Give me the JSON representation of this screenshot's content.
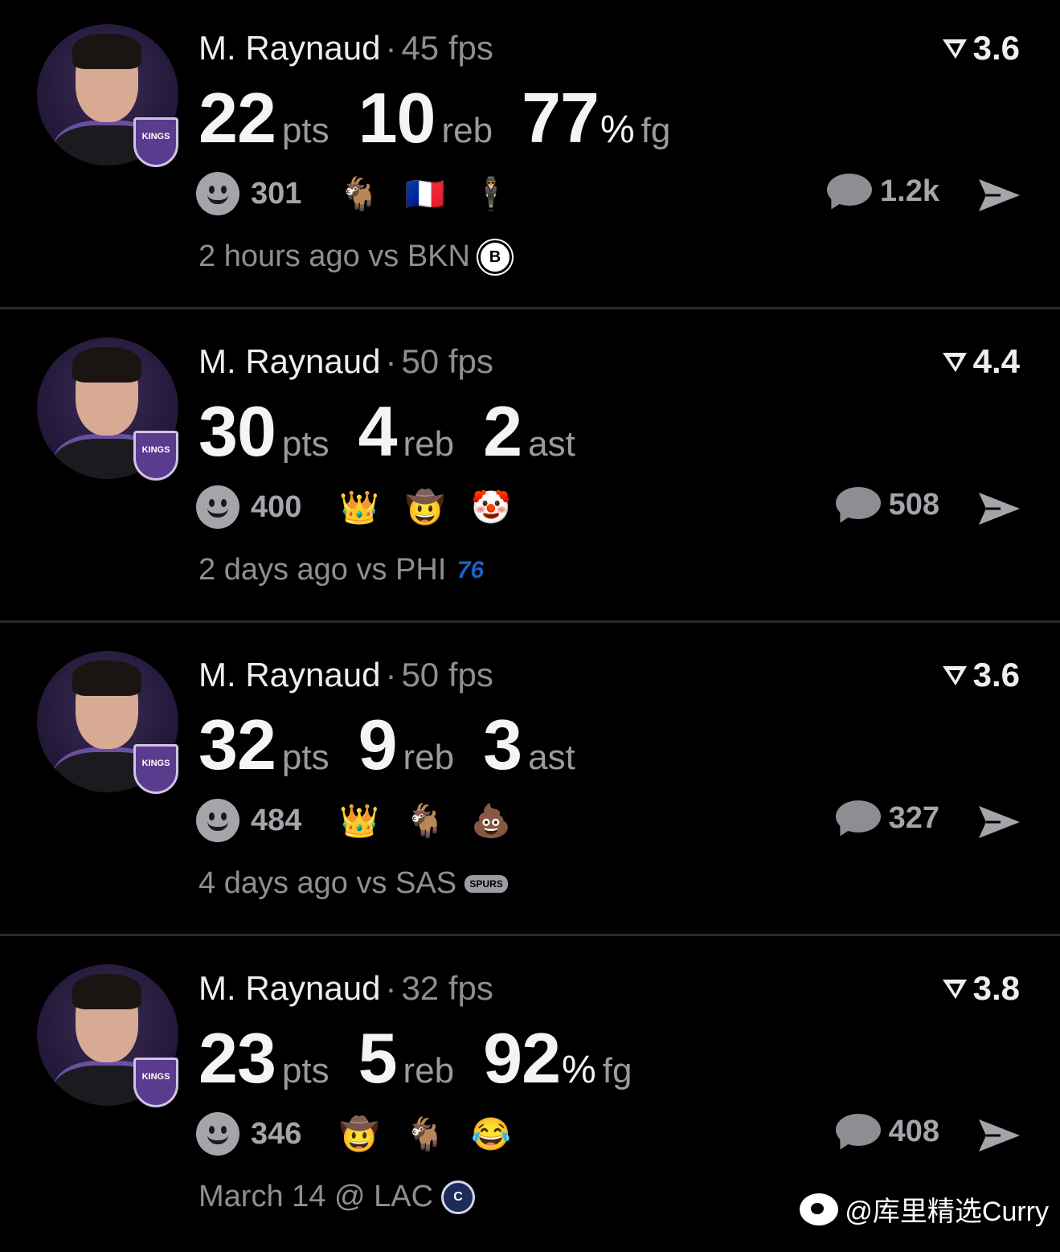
{
  "posts": [
    {
      "player": "M. Raynaud",
      "separator": "·",
      "fps": "45 fps",
      "rating": "3.6",
      "stats": [
        {
          "value": "22",
          "pct": "",
          "unit": "pts"
        },
        {
          "value": "10",
          "pct": "",
          "unit": "reb"
        },
        {
          "value": "77",
          "pct": "%",
          "unit": "fg"
        }
      ],
      "reaction_count": "301",
      "reaction_icons": [
        "goat-icon",
        "france-flag-icon",
        "man-with-hat-icon"
      ],
      "reaction_glyphs": [
        "🐐",
        "🇫🇷",
        "🕴"
      ],
      "comment_count": "1.2k",
      "footer": "2 hours ago vs BKN",
      "team_logo": "B"
    },
    {
      "player": "M. Raynaud",
      "separator": "·",
      "fps": "50 fps",
      "rating": "4.4",
      "stats": [
        {
          "value": "30",
          "pct": "",
          "unit": "pts"
        },
        {
          "value": "4",
          "pct": "",
          "unit": "reb"
        },
        {
          "value": "2",
          "pct": "",
          "unit": "ast"
        }
      ],
      "reaction_count": "400",
      "reaction_icons": [
        "crown-icon",
        "character-icon",
        "clown-icon"
      ],
      "reaction_glyphs": [
        "👑",
        "🤠",
        "🤡"
      ],
      "comment_count": "508",
      "footer": "2 days ago vs PHI",
      "team_logo": "76"
    },
    {
      "player": "M. Raynaud",
      "separator": "·",
      "fps": "50 fps",
      "rating": "3.6",
      "stats": [
        {
          "value": "32",
          "pct": "",
          "unit": "pts"
        },
        {
          "value": "9",
          "pct": "",
          "unit": "reb"
        },
        {
          "value": "3",
          "pct": "",
          "unit": "ast"
        }
      ],
      "reaction_count": "484",
      "reaction_icons": [
        "crown-icon",
        "goat-icon",
        "poop-icon"
      ],
      "reaction_glyphs": [
        "👑",
        "🐐",
        "💩"
      ],
      "comment_count": "327",
      "footer": "4 days ago vs SAS",
      "team_logo": "SPURS"
    },
    {
      "player": "M. Raynaud",
      "separator": "·",
      "fps": "32 fps",
      "rating": "3.8",
      "stats": [
        {
          "value": "23",
          "pct": "",
          "unit": "pts"
        },
        {
          "value": "5",
          "pct": "",
          "unit": "reb"
        },
        {
          "value": "92",
          "pct": "%",
          "unit": "fg"
        }
      ],
      "reaction_count": "346",
      "reaction_icons": [
        "character-icon",
        "goat-icon",
        "tears-of-joy-icon"
      ],
      "reaction_glyphs": [
        "🤠",
        "🐐",
        "😂"
      ],
      "comment_count": "408",
      "footer": "March 14 @ LAC",
      "team_logo": "C"
    }
  ],
  "badge_text": "KINGS",
  "watermark": "@库里精选Curry",
  "colors": {
    "background": "#000000",
    "primary_text": "#f2f2f4",
    "secondary_text": "#8e8e93",
    "icon_gray": "#a4a4aa",
    "kings_purple": "#5a3c8f"
  }
}
